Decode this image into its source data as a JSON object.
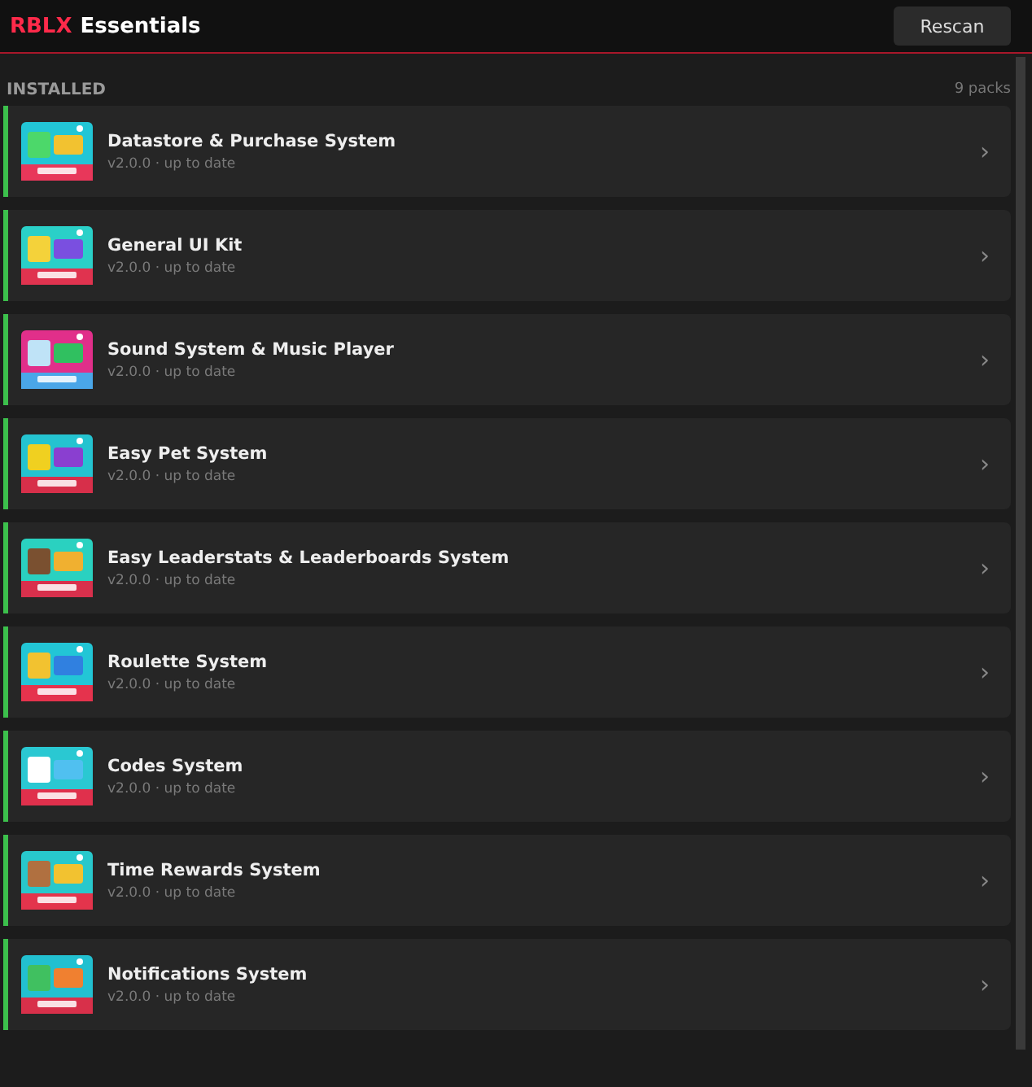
{
  "header": {
    "brand": "RBLX",
    "title": "Essentials",
    "button": "Rescan"
  },
  "section": {
    "title": "INSTALLED",
    "count": "9 packs"
  },
  "packs": [
    {
      "name": "Datastore & Purchase System",
      "status": "v2.0.0 · up to date",
      "chevron": "›"
    },
    {
      "name": "General UI Kit",
      "status": "v2.0.0 · up to date",
      "chevron": "›"
    },
    {
      "name": "Sound System & Music Player",
      "status": "v2.0.0 · up to date",
      "chevron": "›"
    },
    {
      "name": "Easy Pet System",
      "status": "v2.0.0 · up to date",
      "chevron": "›"
    },
    {
      "name": "Easy Leaderstats & Leaderboards System",
      "status": "v2.0.0 · up to date",
      "chevron": "›"
    },
    {
      "name": "Roulette System",
      "status": "v2.0.0 · up to date",
      "chevron": "›"
    },
    {
      "name": "Codes System",
      "status": "v2.0.0 · up to date",
      "chevron": "›"
    },
    {
      "name": "Time Rewards System",
      "status": "v2.0.0 · up to date",
      "chevron": "›"
    },
    {
      "name": "Notifications System",
      "status": "v2.0.0 · up to date",
      "chevron": "›"
    }
  ]
}
